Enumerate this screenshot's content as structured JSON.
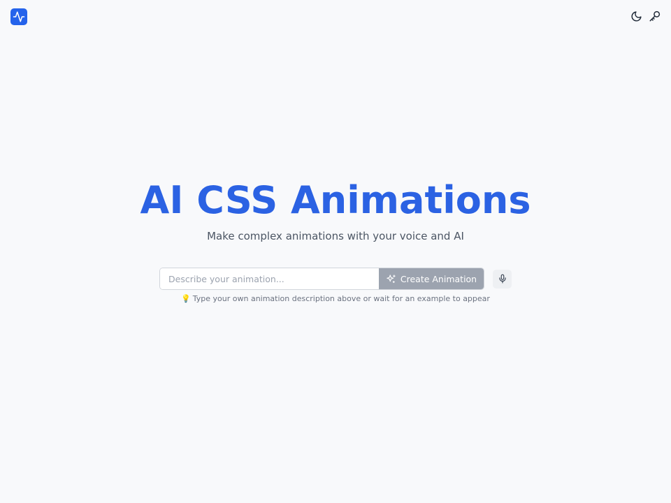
{
  "header": {
    "logo_icon": "activity-pulse-icon",
    "theme_toggle_icon": "moon-icon",
    "api_key_icon": "key-icon"
  },
  "hero": {
    "title": "AI CSS Animations",
    "subtitle": "Make complex animations with your voice and AI"
  },
  "prompt": {
    "placeholder": "Describe your animation...",
    "value": "",
    "create_label": "Create Animation",
    "create_icon": "sparkles-icon",
    "mic_icon": "microphone-icon"
  },
  "hint": {
    "icon": "💡",
    "text": "Type your own animation description above or wait for an example to appear"
  },
  "colors": {
    "accent": "#2b62e3",
    "logo_bg": "#2563eb",
    "button_disabled": "#9ca3af",
    "background": "#f8f9fb"
  }
}
